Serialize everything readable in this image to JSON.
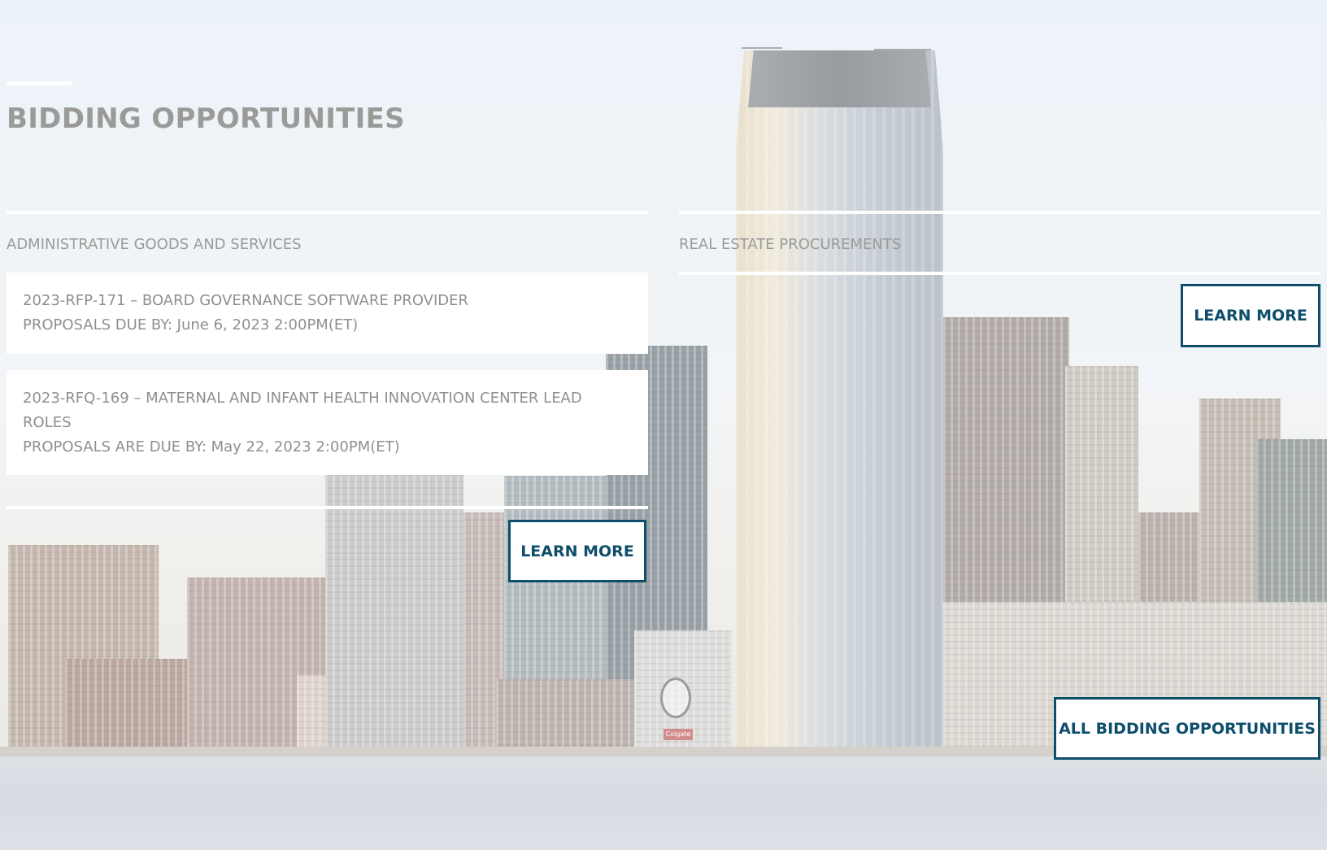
{
  "page_title": "BIDDING OPPORTUNITIES",
  "sections": {
    "administrative": {
      "label": "ADMINISTRATIVE GOODS AND SERVICES",
      "items": [
        {
          "title": "2023-RFP-171 – BOARD GOVERNANCE SOFTWARE PROVIDER",
          "due": "PROPOSALS DUE BY: June 6, 2023 2:00PM(ET)"
        },
        {
          "title": "2023-RFQ-169 – MATERNAL AND INFANT HEALTH INNOVATION CENTER LEAD ROLES",
          "due": "PROPOSALS ARE DUE BY: May 22, 2023 2:00PM(ET)"
        }
      ],
      "button_label": "LEARN MORE"
    },
    "real_estate": {
      "label": "REAL ESTATE PROCUREMENTS",
      "button_label": "LEARN MORE"
    }
  },
  "all_button_label": "ALL BIDDING OPPORTUNITIES",
  "colors": {
    "accent": "#0d4e6b",
    "muted_text": "#9a9a98",
    "card_bg": "#ffffff"
  }
}
